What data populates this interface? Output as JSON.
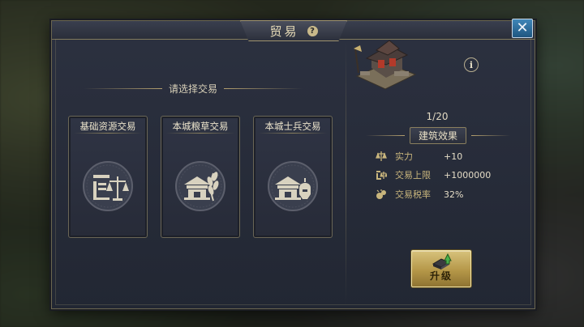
{
  "dialog": {
    "title": "贸易",
    "help_icon": "question-icon",
    "close_icon": "close-icon"
  },
  "trade_section": {
    "heading": "请选择交易",
    "options": [
      {
        "label": "基础资源交易",
        "icon": "resource-scale-icon"
      },
      {
        "label": "本城粮草交易",
        "icon": "grain-icon"
      },
      {
        "label": "本城士兵交易",
        "icon": "soldier-icon"
      }
    ]
  },
  "building": {
    "icon": "market-building-icon",
    "info_icon": "info-icon",
    "level": "1/20",
    "effects_heading": "建筑效果",
    "effects": [
      {
        "icon": "power-icon",
        "label": "实力",
        "value": "+10"
      },
      {
        "icon": "scale-icon",
        "label": "交易上限",
        "value": "+1000000"
      },
      {
        "icon": "tax-icon",
        "label": "交易税率",
        "value": "32%"
      }
    ]
  },
  "upgrade_button": {
    "label": "升级",
    "icon": "upgrade-icon"
  },
  "colors": {
    "gold_label": "#c8b57c",
    "panel_bg": "#262a36",
    "close_blue": "#2f6fa0",
    "upgrade_gold": "#c6ab5c"
  }
}
